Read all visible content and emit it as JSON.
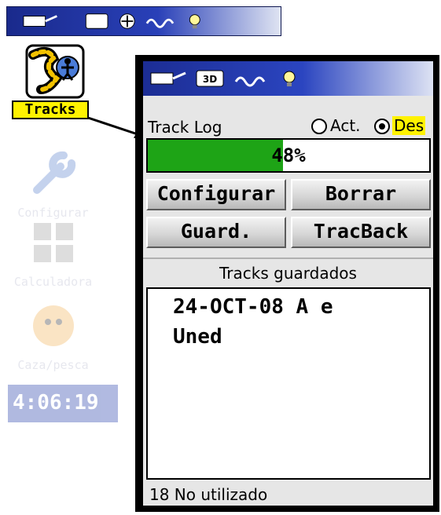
{
  "background_menu": {
    "items": [
      {
        "label": "Tracks"
      },
      {
        "label": "Configurar"
      },
      {
        "label": "Calculadora"
      },
      {
        "label": "Caza/pesca"
      }
    ],
    "clock": "4:06:19"
  },
  "dialog": {
    "track_log_label": "Track Log",
    "radio_on_label": "Act.",
    "radio_off_label": "Des",
    "selected_radio": "Des",
    "progress": {
      "percent": 48,
      "text": "48%"
    },
    "buttons": {
      "configurar": "Configurar",
      "borrar": "Borrar",
      "guardar": "Guard.",
      "tracback": "TracBack"
    },
    "saved_title": "Tracks guardados",
    "saved_tracks": [
      {
        "line1": "24-OCT-08 A e",
        "line2": "Uned"
      }
    ],
    "footer": "18 No utilizado"
  },
  "colors": {
    "status_bar": "#2b45c0",
    "progress_fill": "#1ea416",
    "highlight": "#fff200"
  }
}
